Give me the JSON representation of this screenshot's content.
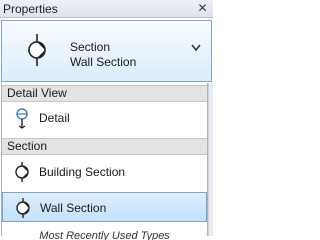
{
  "panel": {
    "title": "Properties",
    "close_glyph": "✕"
  },
  "type_selector": {
    "family": "Section",
    "type": "Wall Section",
    "icon": "section-marker-icon"
  },
  "list": {
    "groups": [
      {
        "header": "Detail View",
        "items": [
          {
            "label": "Detail",
            "icon": "detail-callout-icon",
            "selected": false
          }
        ]
      },
      {
        "header": "Section",
        "items": [
          {
            "label": "Building Section",
            "icon": "section-marker-icon",
            "selected": false
          },
          {
            "label": "Wall Section",
            "icon": "section-marker-icon",
            "selected": true
          }
        ]
      }
    ],
    "footer": "Most Recently Used Types"
  },
  "colors": {
    "selection_fill": "#c5e1fb",
    "selection_border": "#7da2ce",
    "group_header_fill": "#e3e3e3"
  }
}
